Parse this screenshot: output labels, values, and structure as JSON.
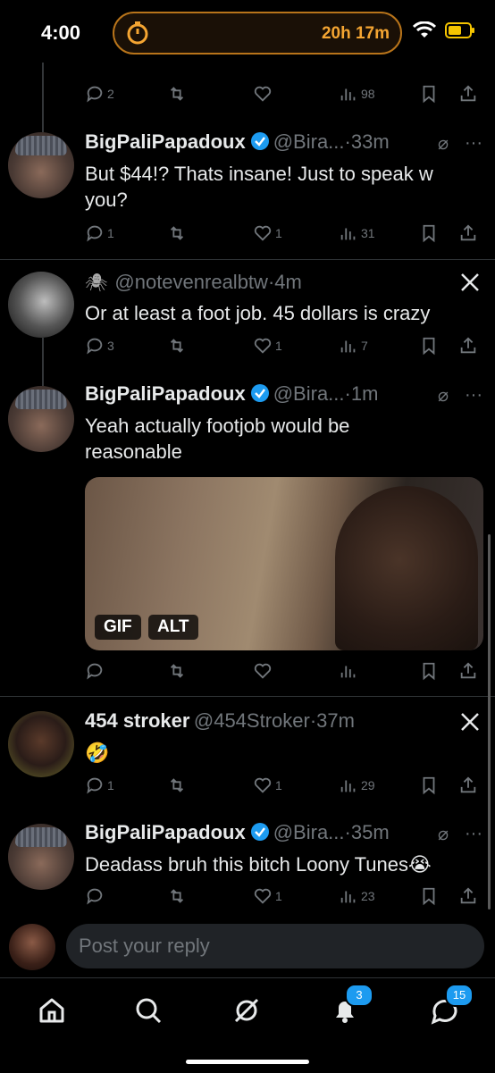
{
  "status_bar": {
    "time": "4:00",
    "timer": "20h 17m"
  },
  "top_actions": {
    "replies": "2",
    "likes": "",
    "views": "98"
  },
  "posts": [
    {
      "name": "BigPaliPapadoux",
      "handle": "@Bira...",
      "time": "33m",
      "text": "But $44!? Thats insane! Just to speak w you?",
      "replies": "1",
      "likes": "1",
      "views": "31"
    },
    {
      "name": "",
      "handle": "@notevenrealbtw",
      "time": "4m",
      "text": "Or at least a foot job. 45 dollars is crazy",
      "replies": "3",
      "likes": "1",
      "views": "7"
    },
    {
      "name": "BigPaliPapadoux",
      "handle": "@Bira...",
      "time": "1m",
      "text": "Yeah actually footjob would be reasonable",
      "media_badges": [
        "GIF",
        "ALT"
      ],
      "replies": "",
      "likes": "",
      "views": ""
    },
    {
      "name": "454 stroker",
      "handle": "@454Stroker",
      "time": "37m",
      "text": "🤣",
      "replies": "1",
      "likes": "1",
      "views": "29"
    },
    {
      "name": "BigPaliPapadoux",
      "handle": "@Bira...",
      "time": "35m",
      "text": "Deadass bruh this bitch Loony Tunes😭",
      "replies": "",
      "likes": "1",
      "views": "23"
    }
  ],
  "reply": {
    "placeholder": "Post your reply"
  },
  "tabbar": {
    "notifications_badge": "3",
    "messages_badge": "15"
  },
  "colors": {
    "accent": "#1d9bf0",
    "muted": "#71767b",
    "timer": "#f4a532"
  }
}
